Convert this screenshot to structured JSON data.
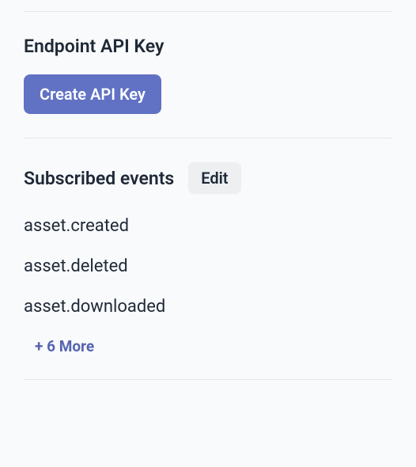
{
  "apiKeySection": {
    "title": "Endpoint API Key",
    "createButtonLabel": "Create API Key"
  },
  "eventsSection": {
    "title": "Subscribed events",
    "editButtonLabel": "Edit",
    "events": [
      "asset.created",
      "asset.deleted",
      "asset.downloaded"
    ],
    "moreLabel": "+ 6 More"
  }
}
